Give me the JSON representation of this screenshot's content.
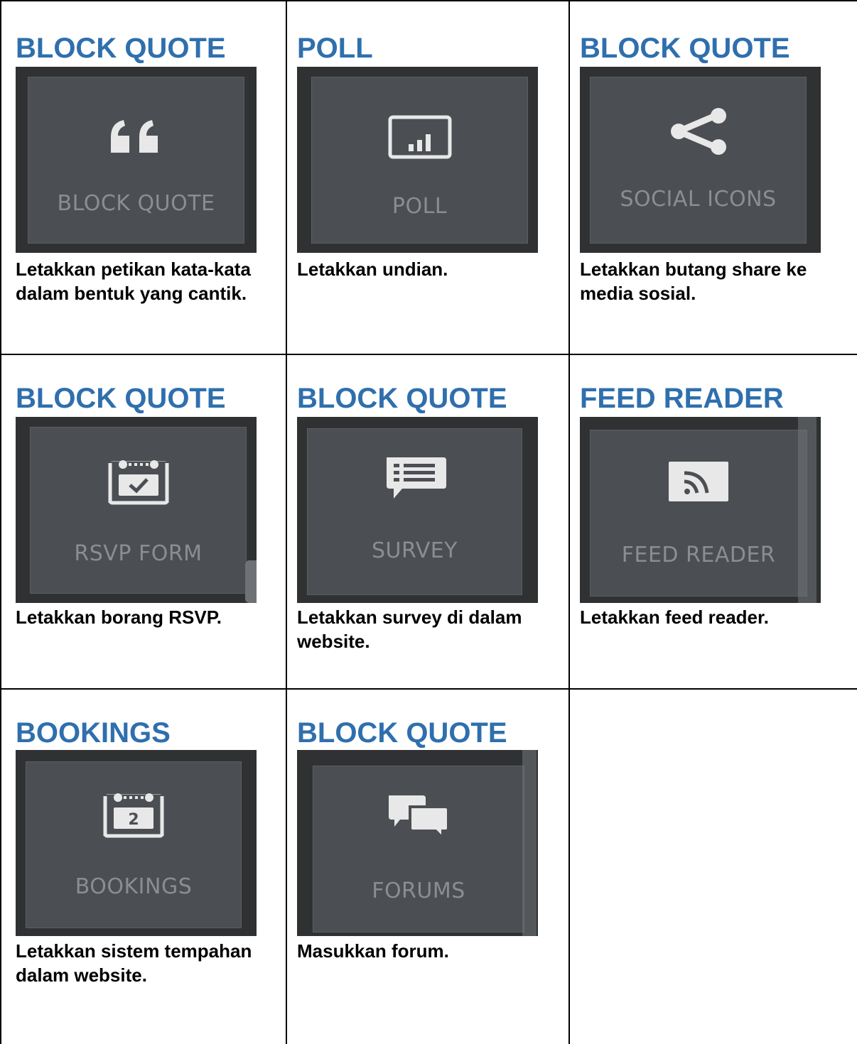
{
  "cells": [
    {
      "title": "BLOCK QUOTE",
      "tile_label": "BLOCK QUOTE",
      "icon": "quote-icon",
      "description": "Letakkan petikan kata-kata dalam bentuk yang cantik."
    },
    {
      "title": "POLL",
      "tile_label": "POLL",
      "icon": "poll-chart-icon",
      "description": "Letakkan undian."
    },
    {
      "title": "BLOCK QUOTE",
      "tile_label": "SOCIAL ICONS",
      "icon": "share-icon",
      "description": "Letakkan butang share ke media sosial."
    },
    {
      "title": "BLOCK QUOTE",
      "tile_label": "RSVP FORM",
      "icon": "calendar-check-icon",
      "description": "Letakkan borang RSVP."
    },
    {
      "title": "BLOCK QUOTE",
      "tile_label": "SURVEY",
      "icon": "speech-list-icon",
      "description": "Letakkan survey di dalam website."
    },
    {
      "title": "FEED READER",
      "tile_label": "FEED READER",
      "icon": "rss-icon",
      "description": "Letakkan feed reader."
    },
    {
      "title": "BOOKINGS",
      "tile_label": "BOOKINGS",
      "icon": "calendar-2-icon",
      "icon_text": "2",
      "description": "Letakkan sistem tempahan dalam website."
    },
    {
      "title": "BLOCK QUOTE",
      "tile_label": "FORUMS",
      "icon": "chat-bubbles-icon",
      "description": "Masukkan forum."
    }
  ],
  "colors": {
    "title": "#2f6fad",
    "tile_outer": "#2f3133",
    "tile_inner": "#4b4f53",
    "tile_label": "#8a8e92",
    "icon": "#e8e8e8"
  }
}
